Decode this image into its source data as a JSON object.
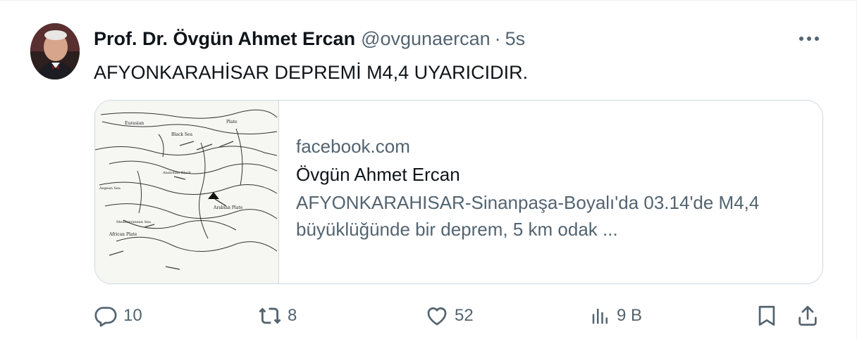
{
  "tweet": {
    "display_name": "Prof. Dr. Övgün Ahmet Ercan",
    "handle": "@ovgunaercan",
    "separator": "·",
    "time": "5s",
    "text": "AFYONKARAHİSAR DEPREMİ M4,4 UYARICIDIR."
  },
  "card": {
    "domain": "facebook.com",
    "title": "Övgün Ahmet Ercan",
    "description": "AFYONKARAHISAR-Sinanpaşa-Boyalı'da 03.14'de M4,4 büyüklüğünde bir deprem, 5 km odak ...",
    "map_labels": {
      "eurasian": "Eurasian",
      "plate_top": "Plate",
      "black_sea": "Black Sea",
      "anatolian_block": "Anatolian Block",
      "arabian_plate": "Arabian Plate",
      "mediterranean_sea": "Mediterranean Sea",
      "african_plate": "African Plate",
      "aegean_sea": "Aegean Sea"
    }
  },
  "actions": {
    "reply_count": "10",
    "retweet_count": "8",
    "like_count": "52",
    "views_count": "9 B"
  },
  "icons": {
    "more": "more-icon",
    "reply": "reply-icon",
    "retweet": "retweet-icon",
    "like": "like-icon",
    "views": "views-icon",
    "bookmark": "bookmark-icon",
    "share": "share-icon"
  },
  "colors": {
    "text_primary": "#0f1419",
    "text_secondary": "#536471",
    "border": "#cfd9de"
  }
}
